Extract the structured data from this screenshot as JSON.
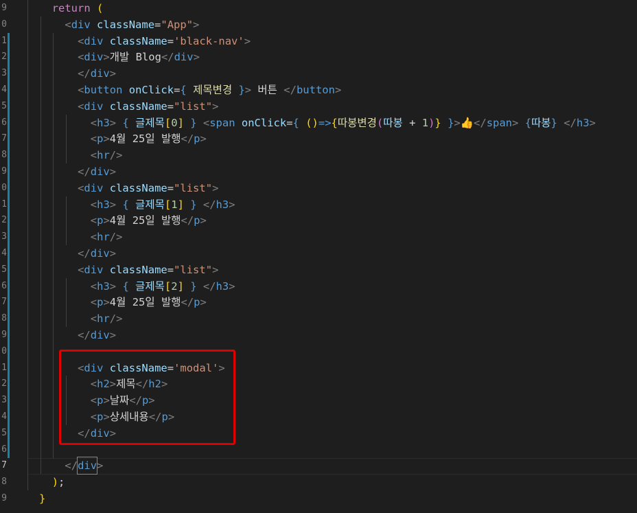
{
  "editor": {
    "line_numbers": [
      "9",
      "0",
      "1",
      "2",
      "3",
      "4",
      "5",
      "6",
      "7",
      "8",
      "9",
      "0",
      "1",
      "2",
      "3",
      "4",
      "5",
      "6",
      "7",
      "8",
      "9",
      "0",
      "1",
      "2",
      "3",
      "4",
      "5",
      "6",
      "7",
      "8",
      "9"
    ],
    "active_line_index": 28,
    "highlight_box_color": "#e00000",
    "lines": [
      [
        {
          "c": "k",
          "v": "return"
        },
        {
          "c": "d",
          "v": " "
        },
        {
          "c": "b1",
          "v": "("
        }
      ],
      [
        {
          "c": "g",
          "v": "<"
        },
        {
          "c": "t",
          "v": "div"
        },
        {
          "c": "d",
          "v": " "
        },
        {
          "c": "a",
          "v": "className"
        },
        {
          "c": "d",
          "v": "="
        },
        {
          "c": "s",
          "v": "\"App\""
        },
        {
          "c": "g",
          "v": ">"
        }
      ],
      [
        {
          "c": "g",
          "v": "<"
        },
        {
          "c": "t",
          "v": "div"
        },
        {
          "c": "d",
          "v": " "
        },
        {
          "c": "a",
          "v": "className"
        },
        {
          "c": "d",
          "v": "="
        },
        {
          "c": "s",
          "v": "'black-nav'"
        },
        {
          "c": "g",
          "v": ">"
        }
      ],
      [
        {
          "c": "g",
          "v": "<"
        },
        {
          "c": "t",
          "v": "div"
        },
        {
          "c": "g",
          "v": ">"
        },
        {
          "c": "d",
          "v": "개발 Blog"
        },
        {
          "c": "g",
          "v": "</"
        },
        {
          "c": "t",
          "v": "div"
        },
        {
          "c": "g",
          "v": ">"
        }
      ],
      [
        {
          "c": "g",
          "v": "</"
        },
        {
          "c": "t",
          "v": "div"
        },
        {
          "c": "g",
          "v": ">"
        }
      ],
      [
        {
          "c": "g",
          "v": "<"
        },
        {
          "c": "t",
          "v": "button"
        },
        {
          "c": "d",
          "v": " "
        },
        {
          "c": "a",
          "v": "onClick"
        },
        {
          "c": "d",
          "v": "="
        },
        {
          "c": "t",
          "v": "{"
        },
        {
          "c": "d",
          "v": " "
        },
        {
          "c": "f",
          "v": "제목변경"
        },
        {
          "c": "d",
          "v": " "
        },
        {
          "c": "t",
          "v": "}"
        },
        {
          "c": "g",
          "v": ">"
        },
        {
          "c": "d",
          "v": " 버튼 "
        },
        {
          "c": "g",
          "v": "</"
        },
        {
          "c": "t",
          "v": "button"
        },
        {
          "c": "g",
          "v": ">"
        }
      ],
      [
        {
          "c": "g",
          "v": "<"
        },
        {
          "c": "t",
          "v": "div"
        },
        {
          "c": "d",
          "v": " "
        },
        {
          "c": "a",
          "v": "className"
        },
        {
          "c": "d",
          "v": "="
        },
        {
          "c": "s",
          "v": "\"list\""
        },
        {
          "c": "g",
          "v": ">"
        }
      ],
      [
        {
          "c": "g",
          "v": "<"
        },
        {
          "c": "t",
          "v": "h3"
        },
        {
          "c": "g",
          "v": ">"
        },
        {
          "c": "d",
          "v": " "
        },
        {
          "c": "t",
          "v": "{"
        },
        {
          "c": "d",
          "v": " "
        },
        {
          "c": "a",
          "v": "글제목"
        },
        {
          "c": "b1",
          "v": "["
        },
        {
          "c": "n",
          "v": "0"
        },
        {
          "c": "b1",
          "v": "]"
        },
        {
          "c": "d",
          "v": " "
        },
        {
          "c": "t",
          "v": "}"
        },
        {
          "c": "d",
          "v": " "
        },
        {
          "c": "g",
          "v": "<"
        },
        {
          "c": "t",
          "v": "span"
        },
        {
          "c": "d",
          "v": " "
        },
        {
          "c": "a",
          "v": "onClick"
        },
        {
          "c": "d",
          "v": "="
        },
        {
          "c": "t",
          "v": "{"
        },
        {
          "c": "d",
          "v": " "
        },
        {
          "c": "b1",
          "v": "()"
        },
        {
          "c": "t",
          "v": "=>"
        },
        {
          "c": "b1",
          "v": "{"
        },
        {
          "c": "f",
          "v": "따봉변경"
        },
        {
          "c": "b2",
          "v": "("
        },
        {
          "c": "a",
          "v": "따봉"
        },
        {
          "c": "d",
          "v": " + "
        },
        {
          "c": "n",
          "v": "1"
        },
        {
          "c": "b2",
          "v": ")"
        },
        {
          "c": "b1",
          "v": "}"
        },
        {
          "c": "d",
          "v": " "
        },
        {
          "c": "t",
          "v": "}"
        },
        {
          "c": "g",
          "v": ">"
        },
        {
          "c": "d",
          "v": "👍"
        },
        {
          "c": "g",
          "v": "</"
        },
        {
          "c": "t",
          "v": "span"
        },
        {
          "c": "g",
          "v": ">"
        },
        {
          "c": "d",
          "v": " "
        },
        {
          "c": "t",
          "v": "{"
        },
        {
          "c": "a",
          "v": "따봉"
        },
        {
          "c": "t",
          "v": "}"
        },
        {
          "c": "d",
          "v": " "
        },
        {
          "c": "g",
          "v": "</"
        },
        {
          "c": "t",
          "v": "h3"
        },
        {
          "c": "g",
          "v": ">"
        }
      ],
      [
        {
          "c": "g",
          "v": "<"
        },
        {
          "c": "t",
          "v": "p"
        },
        {
          "c": "g",
          "v": ">"
        },
        {
          "c": "d",
          "v": "4월 25일 발행"
        },
        {
          "c": "g",
          "v": "</"
        },
        {
          "c": "t",
          "v": "p"
        },
        {
          "c": "g",
          "v": ">"
        }
      ],
      [
        {
          "c": "g",
          "v": "<"
        },
        {
          "c": "t",
          "v": "hr"
        },
        {
          "c": "g",
          "v": "/>"
        }
      ],
      [
        {
          "c": "g",
          "v": "</"
        },
        {
          "c": "t",
          "v": "div"
        },
        {
          "c": "g",
          "v": ">"
        }
      ],
      [
        {
          "c": "g",
          "v": "<"
        },
        {
          "c": "t",
          "v": "div"
        },
        {
          "c": "d",
          "v": " "
        },
        {
          "c": "a",
          "v": "className"
        },
        {
          "c": "d",
          "v": "="
        },
        {
          "c": "s",
          "v": "\"list\""
        },
        {
          "c": "g",
          "v": ">"
        }
      ],
      [
        {
          "c": "g",
          "v": "<"
        },
        {
          "c": "t",
          "v": "h3"
        },
        {
          "c": "g",
          "v": ">"
        },
        {
          "c": "d",
          "v": " "
        },
        {
          "c": "t",
          "v": "{"
        },
        {
          "c": "d",
          "v": " "
        },
        {
          "c": "a",
          "v": "글제목"
        },
        {
          "c": "b1",
          "v": "["
        },
        {
          "c": "n",
          "v": "1"
        },
        {
          "c": "b1",
          "v": "]"
        },
        {
          "c": "d",
          "v": " "
        },
        {
          "c": "t",
          "v": "}"
        },
        {
          "c": "d",
          "v": " "
        },
        {
          "c": "g",
          "v": "</"
        },
        {
          "c": "t",
          "v": "h3"
        },
        {
          "c": "g",
          "v": ">"
        }
      ],
      [
        {
          "c": "g",
          "v": "<"
        },
        {
          "c": "t",
          "v": "p"
        },
        {
          "c": "g",
          "v": ">"
        },
        {
          "c": "d",
          "v": "4월 25일 발행"
        },
        {
          "c": "g",
          "v": "</"
        },
        {
          "c": "t",
          "v": "p"
        },
        {
          "c": "g",
          "v": ">"
        }
      ],
      [
        {
          "c": "g",
          "v": "<"
        },
        {
          "c": "t",
          "v": "hr"
        },
        {
          "c": "g",
          "v": "/>"
        }
      ],
      [
        {
          "c": "g",
          "v": "</"
        },
        {
          "c": "t",
          "v": "div"
        },
        {
          "c": "g",
          "v": ">"
        }
      ],
      [
        {
          "c": "g",
          "v": "<"
        },
        {
          "c": "t",
          "v": "div"
        },
        {
          "c": "d",
          "v": " "
        },
        {
          "c": "a",
          "v": "className"
        },
        {
          "c": "d",
          "v": "="
        },
        {
          "c": "s",
          "v": "\"list\""
        },
        {
          "c": "g",
          "v": ">"
        }
      ],
      [
        {
          "c": "g",
          "v": "<"
        },
        {
          "c": "t",
          "v": "h3"
        },
        {
          "c": "g",
          "v": ">"
        },
        {
          "c": "d",
          "v": " "
        },
        {
          "c": "t",
          "v": "{"
        },
        {
          "c": "d",
          "v": " "
        },
        {
          "c": "a",
          "v": "글제목"
        },
        {
          "c": "b1",
          "v": "["
        },
        {
          "c": "n",
          "v": "2"
        },
        {
          "c": "b1",
          "v": "]"
        },
        {
          "c": "d",
          "v": " "
        },
        {
          "c": "t",
          "v": "}"
        },
        {
          "c": "d",
          "v": " "
        },
        {
          "c": "g",
          "v": "</"
        },
        {
          "c": "t",
          "v": "h3"
        },
        {
          "c": "g",
          "v": ">"
        }
      ],
      [
        {
          "c": "g",
          "v": "<"
        },
        {
          "c": "t",
          "v": "p"
        },
        {
          "c": "g",
          "v": ">"
        },
        {
          "c": "d",
          "v": "4월 25일 발행"
        },
        {
          "c": "g",
          "v": "</"
        },
        {
          "c": "t",
          "v": "p"
        },
        {
          "c": "g",
          "v": ">"
        }
      ],
      [
        {
          "c": "g",
          "v": "<"
        },
        {
          "c": "t",
          "v": "hr"
        },
        {
          "c": "g",
          "v": "/>"
        }
      ],
      [
        {
          "c": "g",
          "v": "</"
        },
        {
          "c": "t",
          "v": "div"
        },
        {
          "c": "g",
          "v": ">"
        }
      ],
      [],
      [
        {
          "c": "g",
          "v": "<"
        },
        {
          "c": "t",
          "v": "div"
        },
        {
          "c": "d",
          "v": " "
        },
        {
          "c": "a",
          "v": "className"
        },
        {
          "c": "d",
          "v": "="
        },
        {
          "c": "s",
          "v": "'modal'"
        },
        {
          "c": "g",
          "v": ">"
        }
      ],
      [
        {
          "c": "g",
          "v": "<"
        },
        {
          "c": "t",
          "v": "h2"
        },
        {
          "c": "g",
          "v": ">"
        },
        {
          "c": "d",
          "v": "제목"
        },
        {
          "c": "g",
          "v": "</"
        },
        {
          "c": "t",
          "v": "h2"
        },
        {
          "c": "g",
          "v": ">"
        }
      ],
      [
        {
          "c": "g",
          "v": "<"
        },
        {
          "c": "t",
          "v": "p"
        },
        {
          "c": "g",
          "v": ">"
        },
        {
          "c": "d",
          "v": "날짜"
        },
        {
          "c": "g",
          "v": "</"
        },
        {
          "c": "t",
          "v": "p"
        },
        {
          "c": "g",
          "v": ">"
        }
      ],
      [
        {
          "c": "g",
          "v": "<"
        },
        {
          "c": "t",
          "v": "p"
        },
        {
          "c": "g",
          "v": ">"
        },
        {
          "c": "d",
          "v": "상세내용"
        },
        {
          "c": "g",
          "v": "</"
        },
        {
          "c": "t",
          "v": "p"
        },
        {
          "c": "g",
          "v": ">"
        }
      ],
      [
        {
          "c": "g",
          "v": "</"
        },
        {
          "c": "t",
          "v": "div"
        },
        {
          "c": "g",
          "v": ">"
        }
      ],
      [],
      [
        {
          "c": "g",
          "v": "</"
        },
        {
          "c": "t",
          "v": "div"
        },
        {
          "c": "g",
          "v": ">"
        }
      ],
      [
        {
          "c": "b1",
          "v": ")"
        },
        {
          "c": "d",
          "v": ";"
        }
      ],
      [
        {
          "c": "b1",
          "v": "}"
        }
      ]
    ]
  }
}
